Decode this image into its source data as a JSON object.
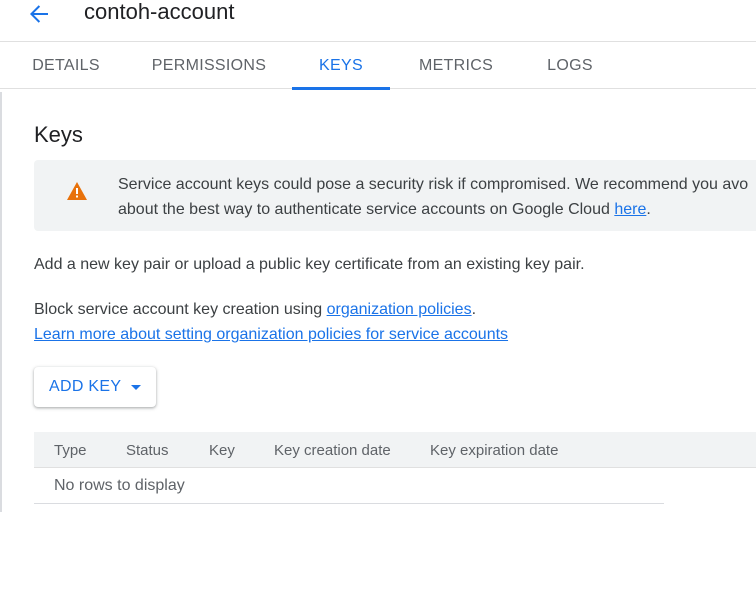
{
  "header": {
    "back_icon": "arrow-back-icon",
    "title": "contoh-account"
  },
  "tabs": [
    {
      "label": "DETAILS",
      "active": false
    },
    {
      "label": "PERMISSIONS",
      "active": false
    },
    {
      "label": "KEYS",
      "active": true
    },
    {
      "label": "METRICS",
      "active": false
    },
    {
      "label": "LOGS",
      "active": false
    }
  ],
  "keys_section": {
    "title": "Keys",
    "banner": {
      "icon": "warning-icon",
      "line1": "Service account keys could pose a security risk if compromised. We recommend you avo",
      "line2_prefix": "about the best way to authenticate service accounts on Google Cloud ",
      "line2_link": "here",
      "line2_suffix": "."
    },
    "intro_text": "Add a new key pair or upload a public key certificate from an existing key pair.",
    "block_text_prefix": "Block service account key creation using ",
    "block_text_link": "organization policies",
    "block_text_suffix": ".",
    "learn_more_link": "Learn more about setting organization policies for service accounts",
    "add_key_label": "ADD KEY"
  },
  "table": {
    "columns": [
      "Type",
      "Status",
      "Key",
      "Key creation date",
      "Key expiration date"
    ],
    "empty_text": "No rows to display"
  },
  "colors": {
    "accent": "#1a73e8",
    "warning": "#e8710a",
    "banner_bg": "#f1f3f4"
  }
}
